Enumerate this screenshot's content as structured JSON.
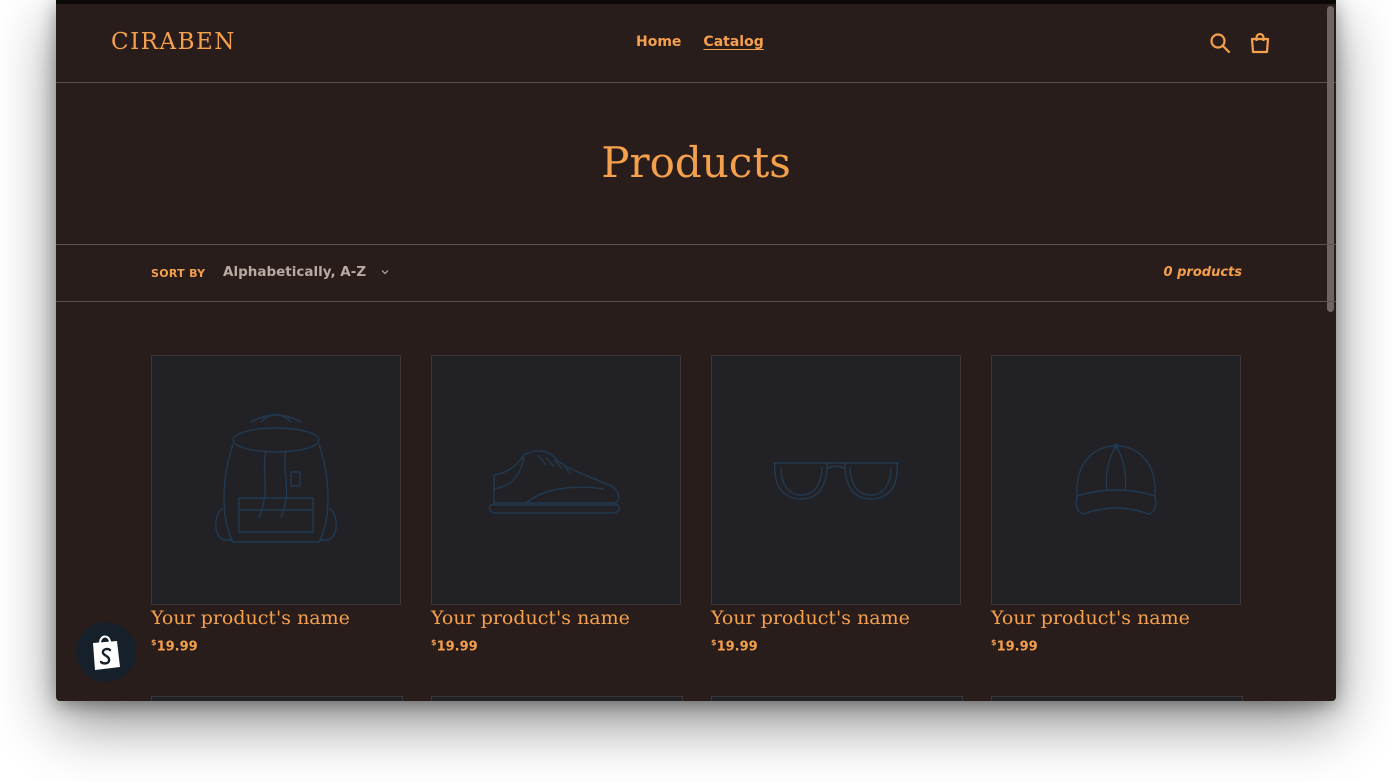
{
  "store": {
    "logo": "CIRABEN"
  },
  "nav": {
    "home": "Home",
    "catalog": "Catalog"
  },
  "icons": {
    "search": "search-icon",
    "cart": "cart-icon",
    "sort_chevron": "chevron-down-icon",
    "badge": "shopify-bag-icon"
  },
  "page": {
    "title": "Products"
  },
  "filters": {
    "sort_label": "SORT BY",
    "sort_value": "Alphabetically, A-Z",
    "product_count": "0 products"
  },
  "products": [
    {
      "name": "Your product's name",
      "currency": "$",
      "price": "19.99",
      "image": "backpack-icon"
    },
    {
      "name": "Your product's name",
      "currency": "$",
      "price": "19.99",
      "image": "sneaker-icon"
    },
    {
      "name": "Your product's name",
      "currency": "$",
      "price": "19.99",
      "image": "sunglasses-icon"
    },
    {
      "name": "Your product's name",
      "currency": "$",
      "price": "19.99",
      "image": "cap-icon"
    }
  ],
  "colors": {
    "accent": "#f5a04c",
    "background": "#291d1c",
    "border": "#5d5150",
    "placeholder_stroke": "#213a52"
  }
}
